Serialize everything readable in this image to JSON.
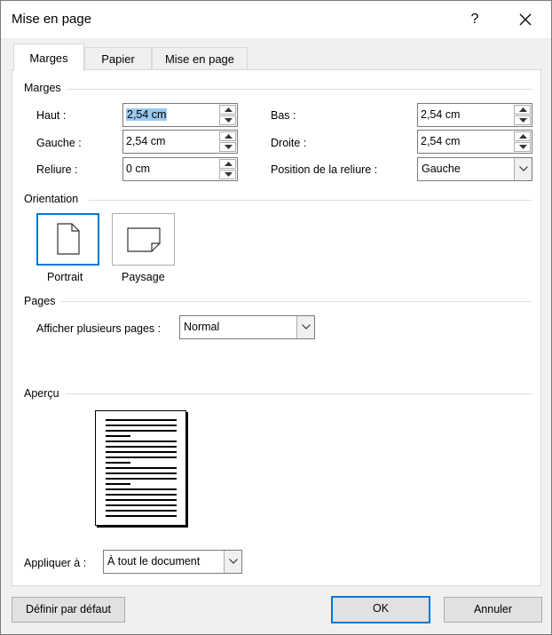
{
  "window": {
    "title": "Mise en page",
    "help_label": "?"
  },
  "tabs": [
    {
      "label": "Marges"
    },
    {
      "label": "Papier"
    },
    {
      "label": "Mise en page"
    }
  ],
  "margins": {
    "section_label": "Marges",
    "top": {
      "label": "Haut :",
      "value": "2,54 cm"
    },
    "left": {
      "label": "Gauche :",
      "value": "2,54 cm"
    },
    "gutter": {
      "label": "Reliure :",
      "value": "0 cm"
    },
    "bottom": {
      "label": "Bas :",
      "value": "2,54 cm"
    },
    "right": {
      "label": "Droite :",
      "value": "2,54 cm"
    },
    "gutter_position": {
      "label": "Position de la reliure :",
      "value": "Gauche"
    }
  },
  "orientation": {
    "section_label": "Orientation",
    "portrait_label": "Portrait",
    "landscape_label": "Paysage",
    "selected": "Portrait"
  },
  "pages": {
    "section_label": "Pages",
    "multiple_label": "Afficher plusieurs pages :",
    "multiple_value": "Normal"
  },
  "preview": {
    "section_label": "Aperçu"
  },
  "apply": {
    "label": "Appliquer à :",
    "value": "À tout le document"
  },
  "buttons": {
    "set_default": "Définir par défaut",
    "ok": "OK",
    "cancel": "Annuler"
  },
  "colors": {
    "accent": "#0078d7",
    "selection": "#99c9ef"
  }
}
